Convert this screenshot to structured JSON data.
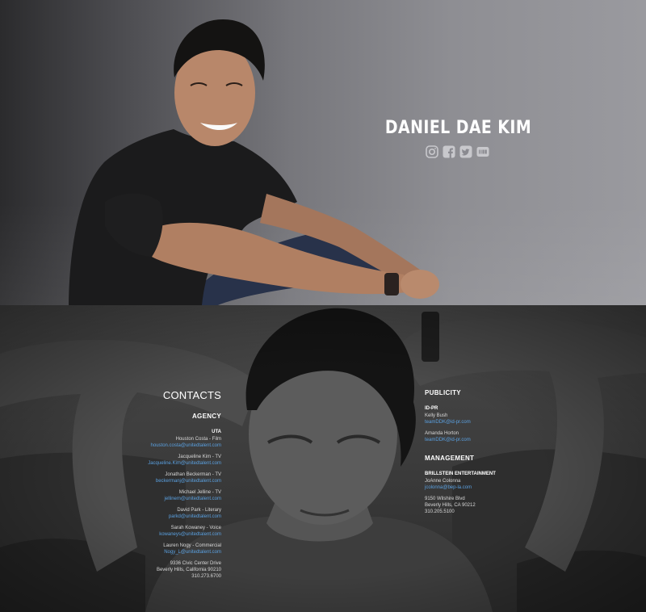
{
  "hero": {
    "name": "DANIEL DAE KIM",
    "social_icons": [
      "instagram-icon",
      "facebook-icon",
      "twitter-icon",
      "imdb-icon"
    ]
  },
  "contacts": {
    "title": "CONTACTS",
    "agency": {
      "heading": "AGENCY",
      "org": "UTA",
      "agents": [
        {
          "name": "Houston Costa - Film",
          "email": "houston.costa@unitedtalent.com"
        },
        {
          "name": "Jacqueline Kim - TV",
          "email": "Jacqueline.Kim@unitedtalent.com"
        },
        {
          "name": "Jonathan Beckerman - TV",
          "email": "beckermanj@unitedtalent.com"
        },
        {
          "name": "Michael Jelline - TV",
          "email": "jellinem@unitedtalent.com"
        },
        {
          "name": "David Park - Literary",
          "email": "parkd@unitedtalent.com"
        },
        {
          "name": "Sarah Kowaney - Voice",
          "email": "kowaneys@unitedtalent.com"
        },
        {
          "name": "Lauren Nogy - Commercial",
          "email": "Nogy_L@unitedtalent.com"
        }
      ],
      "address": [
        "9336 Civic Center Drive",
        "Beverly Hills, California 90210",
        "310.273.6700"
      ]
    },
    "publicity": {
      "heading": "PUBLICITY",
      "org": "ID-PR",
      "contacts": [
        {
          "name": "Kelly Bush",
          "email": "teamDDK@id-pr.com"
        },
        {
          "name": "Amanda Horton",
          "email": "teamDDK@id-pr.com"
        }
      ]
    },
    "management": {
      "heading": "MANAGEMENT",
      "org": "BRILLSTEIN ENTERTAINMENT",
      "contacts": [
        {
          "name": "JoAnne Colonna",
          "email": "jcolonna@bep-la.com"
        }
      ],
      "address": [
        "9150 Wilshire Blvd",
        "Beverly Hills, CA 90212",
        "310.205.5100"
      ]
    }
  }
}
